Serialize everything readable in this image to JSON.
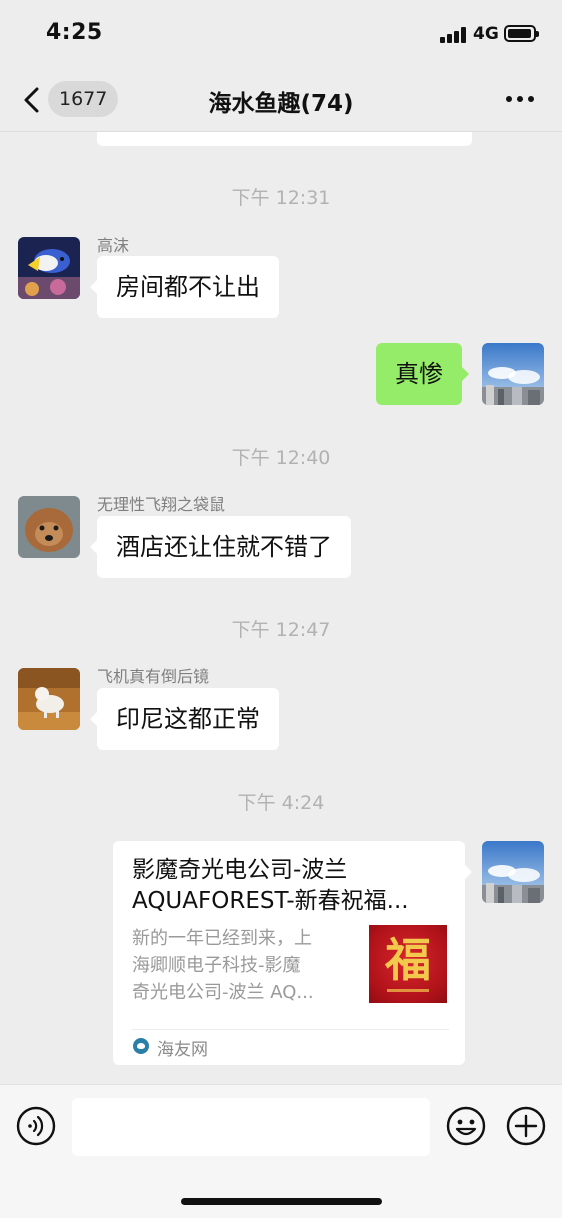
{
  "status_bar": {
    "time": "4:25",
    "network": "4G"
  },
  "nav": {
    "unread_count": "1677",
    "title": "海水鱼趣(74)"
  },
  "messages": [
    {
      "type": "time",
      "text": "下午 12:31"
    },
    {
      "type": "left",
      "sender": "高沫",
      "text": "房间都不让出"
    },
    {
      "type": "right",
      "text": "真惨"
    },
    {
      "type": "time",
      "text": "下午 12:40"
    },
    {
      "type": "left",
      "sender": "无理性飞翔之袋鼠",
      "text": "酒店还让住就不错了"
    },
    {
      "type": "time",
      "text": "下午 12:47"
    },
    {
      "type": "left",
      "sender": "飞机真有倒后镜",
      "text": "印尼这都正常"
    },
    {
      "type": "time",
      "text": "下午 4:24"
    },
    {
      "type": "right-card",
      "title_lines": [
        "影魔奇光电公司-波兰",
        "AQUAFOREST-新春祝福..."
      ],
      "desc_lines": [
        "新的一年已经到来，上",
        "海卿顺电子科技-影魔",
        "奇光电公司-波兰 AQ..."
      ],
      "thumb_char": "福",
      "source": "海友网"
    }
  ],
  "input_bar": {
    "placeholder": ""
  },
  "colors": {
    "background": "#ededed",
    "self_bubble": "#95ec69",
    "other_bubble": "#ffffff",
    "time_text": "#b2b2b2"
  }
}
